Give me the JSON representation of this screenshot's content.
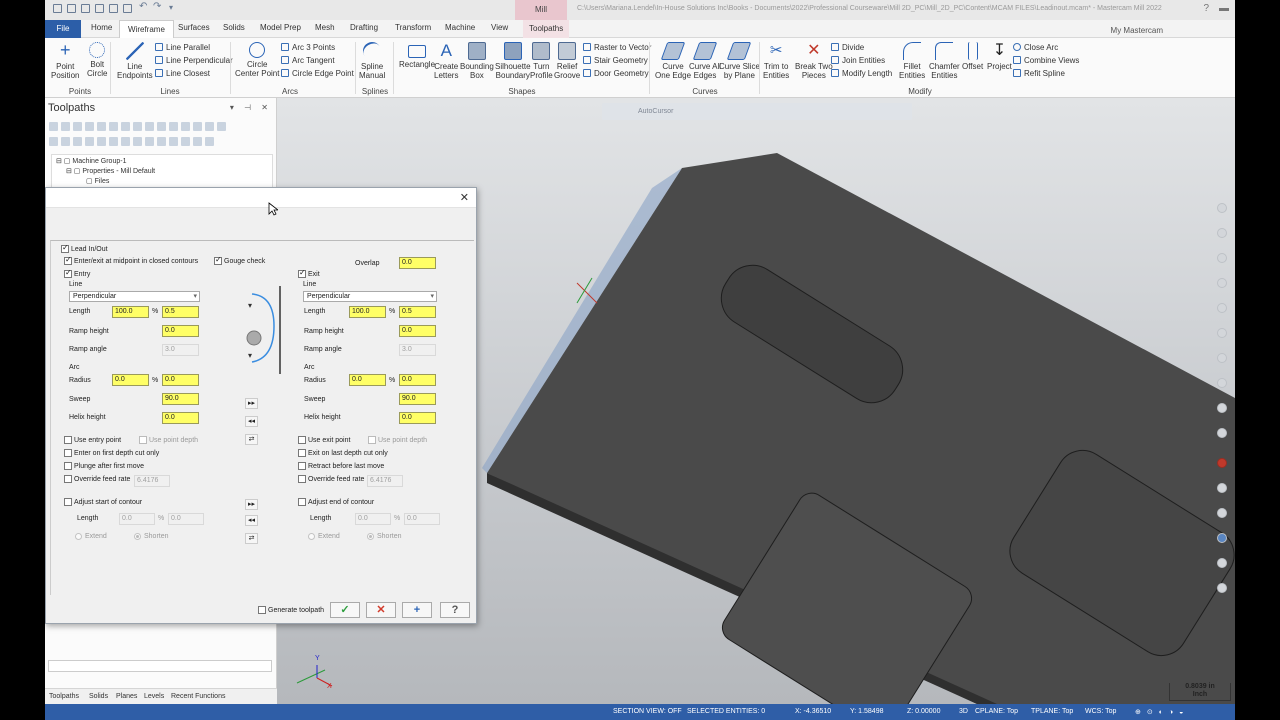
{
  "titlebar": {
    "context_tab": "Mill",
    "title": "C:\\Users\\Mariana.Lendel\\In-House Solutions Inc\\Books - Documents\\2022\\Professional Courseware\\Mill 2D_PC\\Mill_2D_PC\\Content\\MCAM FILES\\Leadinout.mcam* - Mastercam Mill 2022"
  },
  "ribbon_tabs": {
    "file": "File",
    "home": "Home",
    "wireframe": "Wireframe",
    "surfaces": "Surfaces",
    "solids": "Solids",
    "model_prep": "Model Prep",
    "mesh": "Mesh",
    "drafting": "Drafting",
    "transform": "Transform",
    "machine": "Machine",
    "view": "View",
    "toolpaths": "Toolpaths",
    "my_mastercam": "My Mastercam"
  },
  "ribbon": {
    "point_position": "Point\nPosition",
    "bolt_circle": "Bolt\nCircle",
    "line_endpoints": "Line\nEndpoints",
    "line_parallel": "Line Parallel",
    "line_perpendicular": "Line Perpendicular",
    "line_closest": "Line Closest",
    "circle_center_point": "Circle\nCenter Point",
    "arc_3_points": "Arc 3 Points",
    "arc_tangent": "Arc Tangent",
    "circle_edge_point": "Circle Edge Point",
    "spline_manual": "Spline\nManual",
    "rectangle": "Rectangle",
    "create_letters": "Create\nLetters",
    "bounding_box": "Bounding\nBox",
    "silhouette_boundary": "Silhouette\nBoundary",
    "turn_profile": "Turn\nProfile",
    "relief_groove": "Relief\nGroove",
    "raster_to_vector": "Raster to Vector",
    "stair_geometry": "Stair Geometry",
    "door_geometry": "Door Geometry",
    "curve_one_edge": "Curve\nOne Edge",
    "curve_all_edges": "Curve All\nEdges",
    "curve_slice_by_plane": "Curve Slice\nby Plane",
    "trim_to_entities": "Trim to\nEntities",
    "break_two_pieces": "Break Two\nPieces",
    "divide": "Divide",
    "join_entities": "Join Entities",
    "modify_length": "Modify Length",
    "fillet_entities": "Fillet\nEntities",
    "chamfer_entities": "Chamfer\nEntities",
    "offset": "Offset",
    "project": "Project",
    "close_arc": "Close Arc",
    "combine_views": "Combine Views",
    "refit_spline": "Refit Spline",
    "groups": {
      "points": "Points",
      "lines": "Lines",
      "arcs": "Arcs",
      "splines": "Splines",
      "shapes": "Shapes",
      "curves": "Curves",
      "modify": "Modify"
    }
  },
  "manager": {
    "title": "Toolpaths",
    "tree": {
      "machine_group": "Machine Group-1",
      "properties": "Properties - Mill Default",
      "files": "Files"
    },
    "tabs": {
      "toolpaths": "Toolpaths",
      "solids": "Solids",
      "planes": "Planes",
      "levels": "Levels",
      "recent": "Recent Functions"
    }
  },
  "viewport": {
    "autocursor": "AutoCursor",
    "scale": "0.8039 in",
    "scale_unit": "Inch"
  },
  "statusbar": {
    "section_view": "SECTION VIEW: OFF",
    "selected": "SELECTED ENTITIES: 0",
    "x": "X:  -4.36510",
    "y": "Y:  1.58498",
    "z": "Z:  0.00000",
    "mode": "3D",
    "cplane": "CPLANE: Top",
    "tplane": "TPLANE: Top",
    "wcs": "WCS: Top"
  },
  "dialog": {
    "lead_in_out": "Lead In/Out",
    "enter_exit_midpoint": "Enter/exit at midpoint in closed contours",
    "gouge_check": "Gouge check",
    "overlap_label": "Overlap",
    "overlap_value": "0.0",
    "entry": {
      "title": "Entry",
      "line_group": "Line",
      "line_type": "Perpendicular",
      "length_label": "Length",
      "length_pct": "100.0",
      "length_value": "0.5",
      "ramp_height_label": "Ramp height",
      "ramp_height": "0.0",
      "ramp_angle_label": "Ramp angle",
      "ramp_angle": "3.0",
      "arc_group": "Arc",
      "radius_label": "Radius",
      "radius_pct": "0.0",
      "radius_value": "0.0",
      "sweep_label": "Sweep",
      "sweep": "90.0",
      "helix_label": "Helix height",
      "helix": "0.0",
      "use_point": "Use entry point",
      "use_point_depth": "Use point depth",
      "first_depth": "Enter on first depth cut only",
      "plunge_after": "Plunge after first move",
      "override_feed": "Override feed rate",
      "feed_rate": "6.4176",
      "adjust_contour": "Adjust start of contour",
      "adj_length_label": "Length",
      "adj_length": "0.0",
      "adj_pct": "0.0",
      "extend": "Extend",
      "shorten": "Shorten"
    },
    "exit": {
      "title": "Exit",
      "line_group": "Line",
      "line_type": "Perpendicular",
      "length_label": "Length",
      "length_pct": "100.0",
      "length_value": "0.5",
      "ramp_height_label": "Ramp height",
      "ramp_height": "0.0",
      "ramp_angle_label": "Ramp angle",
      "ramp_angle": "3.0",
      "arc_group": "Arc",
      "radius_label": "Radius",
      "radius_pct": "0.0",
      "radius_value": "0.0",
      "sweep_label": "Sweep",
      "sweep": "90.0",
      "helix_label": "Helix height",
      "helix": "0.0",
      "use_point": "Use exit point",
      "use_point_depth": "Use point depth",
      "first_depth": "Exit on last depth cut only",
      "plunge_after": "Retract before last move",
      "override_feed": "Override feed rate",
      "feed_rate": "6.4176",
      "adjust_contour": "Adjust end of contour",
      "adj_length_label": "Length",
      "adj_length": "0.0",
      "adj_pct": "0.0",
      "extend": "Extend",
      "shorten": "Shorten"
    },
    "pct": "%",
    "generate_toolpath": "Generate toolpath",
    "ok_icon": "✓",
    "cancel_icon": "✕",
    "apply_icon": "+",
    "help_icon": "?"
  }
}
